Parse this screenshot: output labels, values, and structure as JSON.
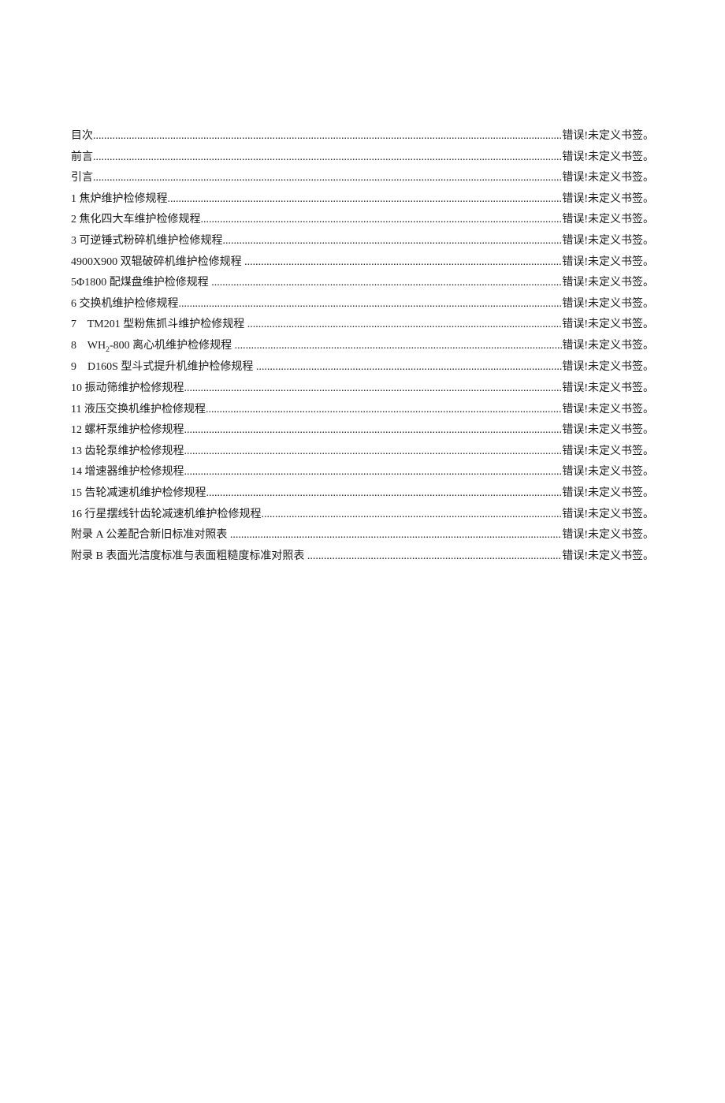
{
  "toc": {
    "items": [
      {
        "label": "目次",
        "page": "错误!未定义书签。"
      },
      {
        "label": "前言",
        "page": "错误!未定义书签。"
      },
      {
        "label": "引言",
        "page": "错误!未定义书签。"
      },
      {
        "label": "1 焦炉维护检修规程",
        "page": "错误!未定义书签。"
      },
      {
        "label": "2 焦化四大车维护检修规程",
        "page": "错误!未定义书签。"
      },
      {
        "label": "3 可逆锤式粉碎机维护检修规程",
        "page": "错误!未定义书签。"
      },
      {
        "label": "4900X900 双辊破碎机维护检修规程 ",
        "page": "错误!未定义书签。"
      },
      {
        "label": "5Φ1800 配煤盘维护检修规程 ",
        "page": "错误!未定义书签。"
      },
      {
        "label": "6 交换机维护检修规程",
        "page": "错误!未定义书签。"
      },
      {
        "label": "7    TM201 型粉焦抓斗维护检修规程 ",
        "page": "错误!未定义书签。"
      },
      {
        "label_html": "8    WH<sub>2</sub>-800 离心机维护检修规程 ",
        "label": "8    WH2-800 离心机维护检修规程 ",
        "page": "错误!未定义书签。"
      },
      {
        "label": "9    D160S 型斗式提升机维护检修规程 ",
        "page": "错误!未定义书签。"
      },
      {
        "label": "10 振动筛维护检修规程",
        "page": "错误!未定义书签。"
      },
      {
        "label": "11 液压交换机维护检修规程",
        "page": "错误!未定义书签。"
      },
      {
        "label": "12 螺杆泵维护检修规程",
        "page": "错误!未定义书签。"
      },
      {
        "label": "13 齿轮泵维护检修规程",
        "page": "错误!未定义书签。"
      },
      {
        "label": "14 增速器维护检修规程",
        "page": "错误!未定义书签。"
      },
      {
        "label": "15 告轮减速机维护检修规程",
        "page": "错误!未定义书签。"
      },
      {
        "label": "16 行星摆线针齿轮减速机维护检修规程",
        "page": "错误!未定义书签。"
      },
      {
        "label": "附录 A 公差配合新旧标准对照表 ",
        "page": "错误!未定义书签。"
      },
      {
        "label": "附录 B 表面光洁度标准与表面粗糙度标准对照表 ",
        "page": "错误!未定义书签。"
      }
    ]
  }
}
